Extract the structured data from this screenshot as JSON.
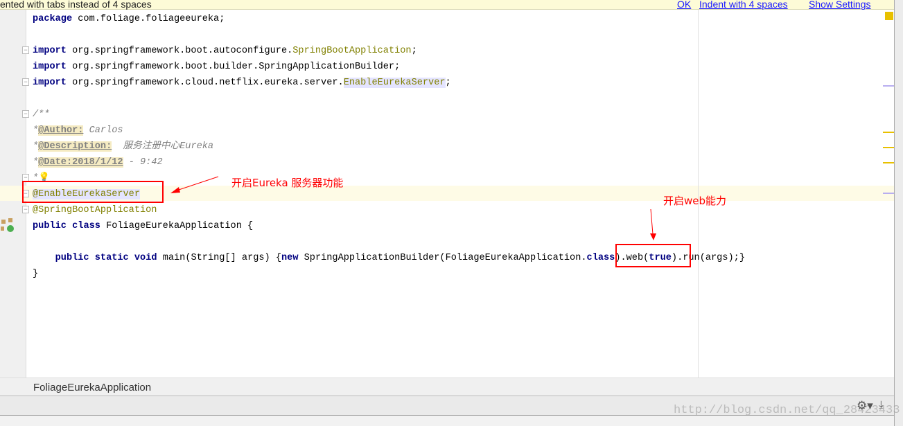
{
  "banner": {
    "message": "ented with tabs instead of 4 spaces",
    "ok": "OK",
    "indent": "Indent with 4 spaces",
    "settings": "Show Settings"
  },
  "code_lines": [
    [
      {
        "t": "package",
        "c": "kw"
      },
      {
        "t": " com.foliage.foliageeureka;"
      }
    ],
    [],
    [
      {
        "t": "import",
        "c": "kw"
      },
      {
        "t": " org.springframework.boot.autoconfigure."
      },
      {
        "t": "SpringBootApplication",
        "c": "ann"
      },
      {
        "t": ";"
      }
    ],
    [
      {
        "t": "import",
        "c": "kw"
      },
      {
        "t": " org.springframework.boot.builder.SpringApplicationBuilder;"
      }
    ],
    [
      {
        "t": "import",
        "c": "kw"
      },
      {
        "t": " org.springframework.cloud.netflix.eureka.server."
      },
      {
        "t": "EnableEurekaServer",
        "c": "ann hl"
      },
      {
        "t": ";"
      }
    ],
    [],
    [
      {
        "t": "/**",
        "c": "cm"
      }
    ],
    [
      {
        "t": "*",
        "c": "cm"
      },
      {
        "t": "@Author:",
        "c": "tag"
      },
      {
        "t": " Carlos",
        "c": "cm"
      }
    ],
    [
      {
        "t": "*",
        "c": "cm"
      },
      {
        "t": "@Description:",
        "c": "tag"
      },
      {
        "t": "  服务注册中心",
        "c": "cm"
      },
      {
        "t": "Eureka",
        "c": "cm"
      }
    ],
    [
      {
        "t": "*",
        "c": "cm"
      },
      {
        "t": "@Date:2018/1/12",
        "c": "tag"
      },
      {
        "t": " - 9:42",
        "c": "cm"
      }
    ],
    [
      {
        "t": "*",
        "c": "cm"
      },
      {
        "t": "💡"
      }
    ],
    [
      {
        "t": "@EnableEurekaServer",
        "c": "ann hl"
      }
    ],
    [
      {
        "t": "@SpringBootApplication",
        "c": "ann"
      }
    ],
    [
      {
        "t": "public",
        "c": "kw"
      },
      {
        "t": " "
      },
      {
        "t": "class",
        "c": "kw"
      },
      {
        "t": " FoliageEurekaApplication {"
      }
    ],
    [],
    [
      {
        "t": "    "
      },
      {
        "t": "public",
        "c": "kw"
      },
      {
        "t": " "
      },
      {
        "t": "static",
        "c": "kw"
      },
      {
        "t": " "
      },
      {
        "t": "void",
        "c": "kw"
      },
      {
        "t": " main(String[] args) {"
      },
      {
        "t": "new",
        "c": "kw"
      },
      {
        "t": " SpringApplicationBuilder(FoliageEurekaApplication."
      },
      {
        "t": "class",
        "c": "kw"
      },
      {
        "t": ").web("
      },
      {
        "t": "true",
        "c": "kw"
      },
      {
        "t": ").run(args);}"
      }
    ],
    [
      {
        "t": "}"
      }
    ]
  ],
  "annotations": {
    "eureka_note": "开启Eureka 服务器功能",
    "web_note": "开启web能力"
  },
  "breadcrumb": "FoliageEurekaApplication",
  "watermark": "http://blog.csdn.net/qq_28423433",
  "colors": {
    "annotation_red": "#ff0000",
    "keyword": "#000080"
  }
}
